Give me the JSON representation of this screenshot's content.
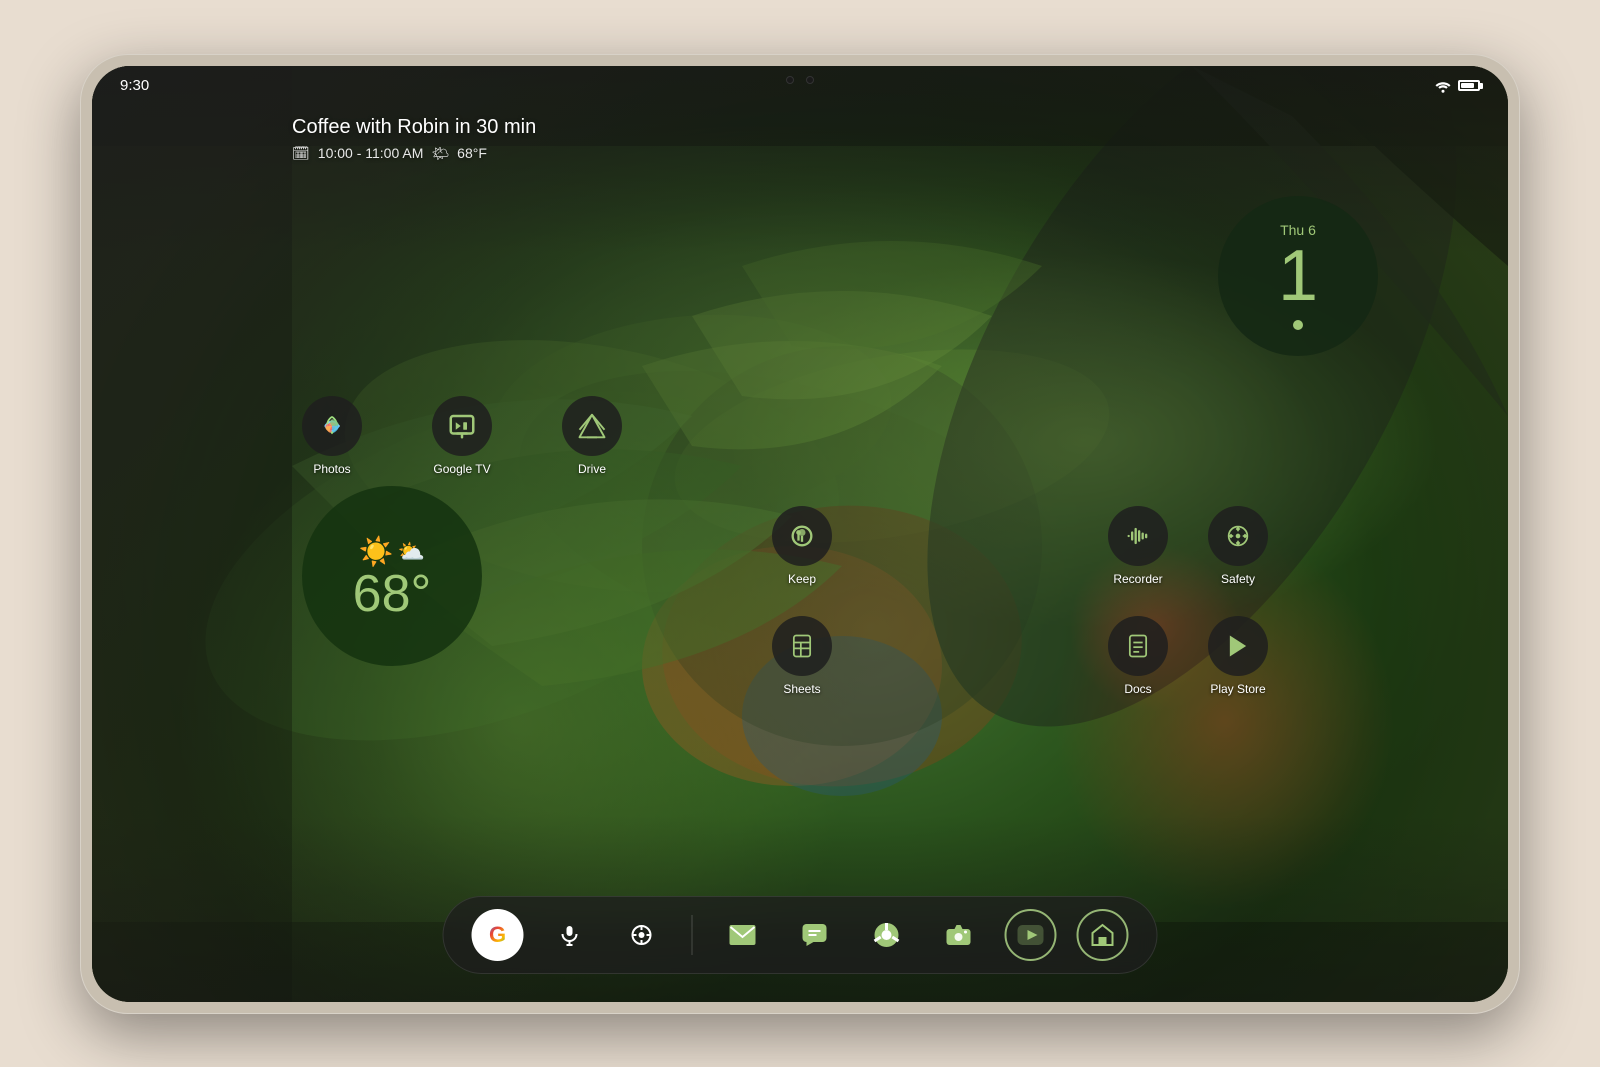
{
  "device": {
    "type": "tablet",
    "model": "Pixel Tablet"
  },
  "status_bar": {
    "time": "9:30",
    "wifi": true,
    "battery_level": 70
  },
  "calendar_widget": {
    "title": "Coffee with Robin in 30 min",
    "time_range": "10:00 - 11:00 AM",
    "temperature": "68°F"
  },
  "clock_widget": {
    "day": "Thu 6",
    "number": "1",
    "accent_color": "#a0c878"
  },
  "weather_widget": {
    "temperature": "68°",
    "condition": "partly_cloudy"
  },
  "app_icons": {
    "top_row": [
      {
        "name": "Photos",
        "emoji": "🌸"
      },
      {
        "name": "Google TV",
        "emoji": "📺"
      },
      {
        "name": "Drive",
        "emoji": "△"
      }
    ],
    "middle_center": [
      {
        "name": "Keep",
        "emoji": "💡"
      },
      {
        "name": "Sheets",
        "emoji": "📊"
      }
    ],
    "middle_right_row1": [
      {
        "name": "Recorder",
        "emoji": "🎙"
      },
      {
        "name": "Safety",
        "emoji": "❋"
      }
    ],
    "middle_right_row2": [
      {
        "name": "Docs",
        "emoji": "📄"
      },
      {
        "name": "Play Store",
        "emoji": "▶"
      }
    ]
  },
  "dock": {
    "items": [
      {
        "name": "Google Search",
        "type": "google"
      },
      {
        "name": "Microphone",
        "type": "mic"
      },
      {
        "name": "Lens",
        "type": "lens"
      },
      {
        "name": "Gmail",
        "type": "gmail"
      },
      {
        "name": "Messages",
        "type": "messages"
      },
      {
        "name": "Chrome",
        "type": "chrome"
      },
      {
        "name": "Camera",
        "type": "camera"
      },
      {
        "name": "YouTube",
        "type": "youtube"
      },
      {
        "name": "Pixel Launcher",
        "type": "pixelhome"
      }
    ]
  }
}
